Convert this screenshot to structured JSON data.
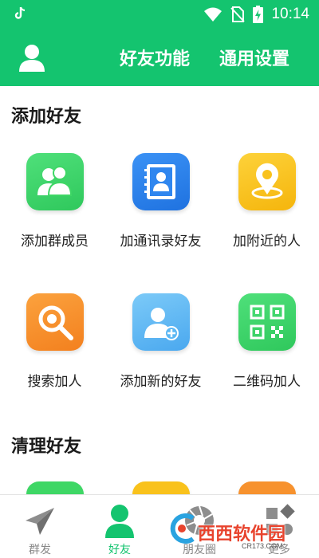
{
  "status_bar": {
    "time": "10:14",
    "icons": [
      "tiktok-icon",
      "wifi-icon",
      "no-sim-icon",
      "battery-charging-icon"
    ]
  },
  "app_bar": {
    "avatar_icon": "user-icon",
    "tabs": [
      {
        "label": "好友功能"
      },
      {
        "label": "通用设置"
      }
    ]
  },
  "sections": [
    {
      "title": "添加好友",
      "items": [
        {
          "label": "添加群成员",
          "icon": "group-members-icon",
          "color": "#3ed765"
        },
        {
          "label": "加通讯录好友",
          "icon": "contacts-book-icon",
          "color": "#2f86ef"
        },
        {
          "label": "加附近的人",
          "icon": "location-pin-icon",
          "color": "#f9c21c"
        },
        {
          "label": "搜索加人",
          "icon": "search-icon",
          "color": "#f7922e"
        },
        {
          "label": "添加新的好友",
          "icon": "add-friend-icon",
          "color": "#5db8f4"
        },
        {
          "label": "二维码加人",
          "icon": "qr-code-icon",
          "color": "#3ed765"
        }
      ]
    },
    {
      "title": "清理好友",
      "items": [
        {
          "icon": "clean-icon-1",
          "color": "#3ed765"
        },
        {
          "icon": "clean-icon-2",
          "color": "#f9c21c"
        },
        {
          "icon": "clean-icon-3",
          "color": "#f7922e"
        }
      ]
    }
  ],
  "bottom_nav": {
    "items": [
      {
        "label": "群发",
        "icon": "paper-plane-icon"
      },
      {
        "label": "好友",
        "icon": "person-icon",
        "active": true
      },
      {
        "label": "朋友圈",
        "icon": "camera-aperture-icon"
      },
      {
        "label": "更多",
        "icon": "more-shapes-icon"
      }
    ],
    "active_color": "#14c46f"
  },
  "watermark": {
    "text": "西西软件园",
    "sub": "CR173.COM"
  },
  "colors": {
    "brand_green": "#14c46f"
  }
}
